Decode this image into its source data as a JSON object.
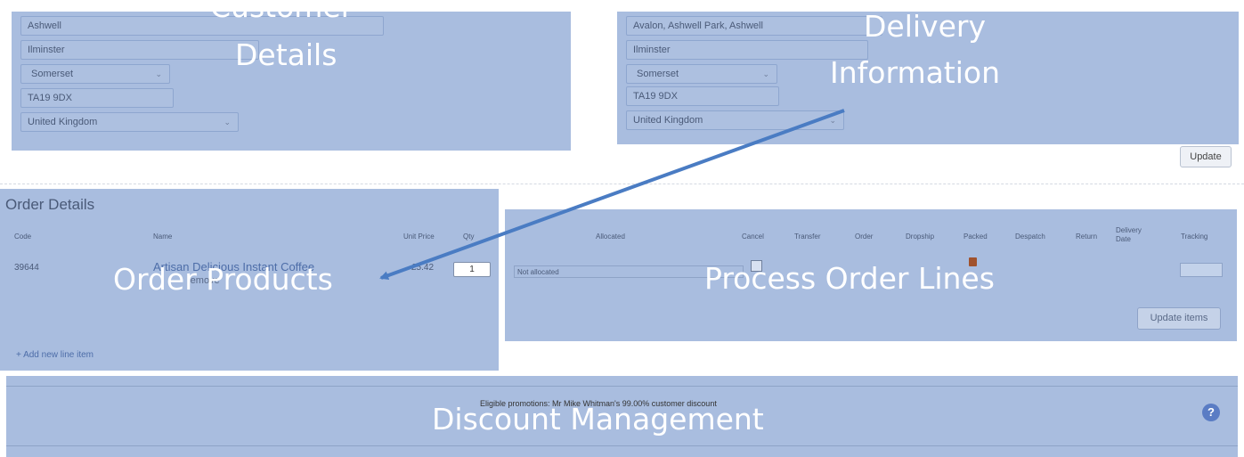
{
  "customer": {
    "overlay_line1": "Customer",
    "overlay_line2": "Details",
    "town": "Ashwell",
    "city": "Ilminster",
    "county": "Somerset",
    "postcode": "TA19 9DX",
    "country": "United Kingdom"
  },
  "delivery": {
    "overlay_line1": "Delivery",
    "overlay_line2": "Information",
    "address": "Avalon, Ashwell Park, Ashwell",
    "city": "Ilminster",
    "county": "Somerset",
    "postcode": "TA19 9DX",
    "country": "United Kingdom"
  },
  "update_button": "Update",
  "order": {
    "title": "Order Details",
    "overlay": "Order Products",
    "headers": {
      "code": "Code",
      "name": "Name",
      "unit_price": "Unit Price",
      "qty": "Qty"
    },
    "rows": [
      {
        "code": "39644",
        "name": "Artisan Delicious Instant Coffee",
        "sub": "remove",
        "unit_price": "£5.42",
        "qty": "1"
      }
    ],
    "add_line": "+  Add new line item"
  },
  "process": {
    "overlay": "Process Order Lines",
    "headers": {
      "allocated": "Allocated",
      "cancel": "Cancel",
      "transfer": "Transfer",
      "order": "Order",
      "dropship": "Dropship",
      "packed": "Packed",
      "despatch": "Despatch",
      "return": "Return",
      "delivery_date_1": "Delivery",
      "delivery_date_2": "Date",
      "tracking": "Tracking"
    },
    "allocated_value": "Not allocated",
    "update_items": "Update items"
  },
  "discount": {
    "overlay": "Discount Management",
    "promotions": "Eligible promotions: Mr Mike Whitman's 99.00% customer discount",
    "help": "?"
  },
  "colors": {
    "panel": "#a9bddf",
    "arrow": "#4a7cc3",
    "help_icon": "#5a7cc4",
    "packed_icon": "#a0522d"
  }
}
